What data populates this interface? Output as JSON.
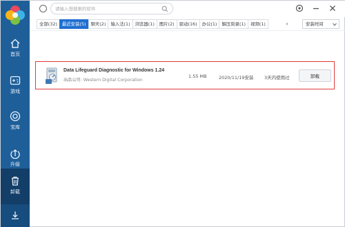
{
  "search": {
    "placeholder": "请输入想搜索的软件"
  },
  "sidebar": {
    "items": [
      {
        "label": "首页",
        "icon": "home-icon"
      },
      {
        "label": "游戏",
        "icon": "gamepad-icon"
      },
      {
        "label": "宝库",
        "icon": "treasure-icon"
      },
      {
        "label": "升级",
        "icon": "upgrade-icon"
      },
      {
        "label": "卸载",
        "icon": "trash-icon"
      }
    ],
    "active": "卸载",
    "bottom_icon": "download-icon"
  },
  "tabs": [
    {
      "label": "全部(32)"
    },
    {
      "label": "最近安装(5)"
    },
    {
      "label": "聊天(2)"
    },
    {
      "label": "输入法(1)"
    },
    {
      "label": "浏览器(1)"
    },
    {
      "label": "图片(2)"
    },
    {
      "label": "驱动(16)"
    },
    {
      "label": "办公(1)"
    },
    {
      "label": "解压刻录(1)"
    },
    {
      "label": "视频(1)"
    }
  ],
  "tabs_more": "›",
  "sort": {
    "selected": "安装时间"
  },
  "app": {
    "name": "Data Lifeguard Diagnostic for Windows 1.24",
    "publisher": "出品公司: Western Digital Corporation",
    "size": "1.55 MB",
    "date": "2020/11/19安装",
    "usage": "3天内使用过",
    "uninstall_label": "卸载"
  },
  "colors": {
    "sidebar": "#1f5f99",
    "sidebar_active": "#123e68",
    "tab_active": "#1f6fd1",
    "highlight_border": "#e03a3a"
  }
}
